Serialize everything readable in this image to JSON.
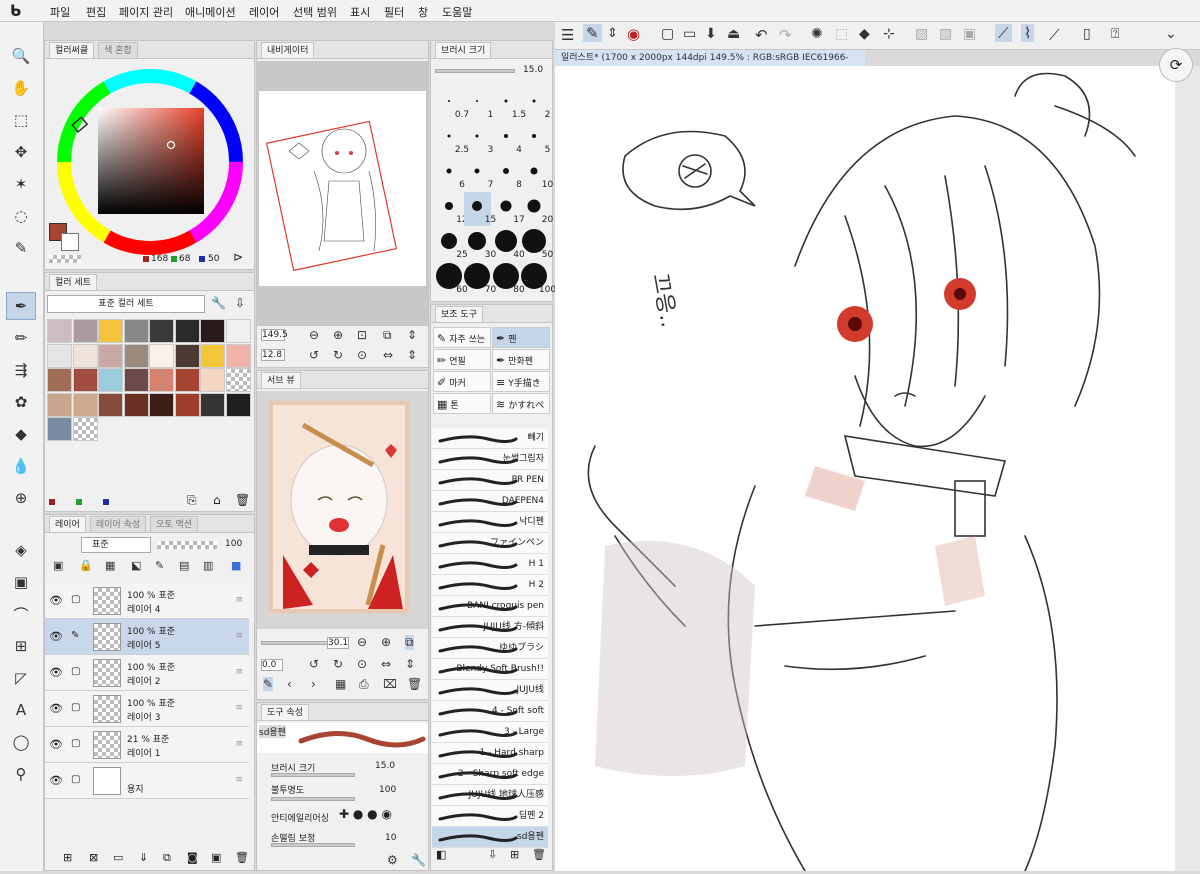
{
  "menu": [
    "파일",
    "편집",
    "페이지 관리",
    "애니메이션",
    "레이어",
    "선택 범위",
    "표시",
    "필터",
    "창",
    "도움말"
  ],
  "color_panel": {
    "tabs": [
      "컬러써클",
      "색 혼합"
    ],
    "r": "168",
    "g": "68",
    "b": "50",
    "main_color": "#a84432"
  },
  "color_set": {
    "tabs": [
      "컬러 세트"
    ],
    "set_name": "표준 컬러 세트",
    "swatches": [
      "#cdbcc4",
      "#a89aa0",
      "#f2c43d",
      "#888888",
      "#3a3a3a",
      "#2a2a2a",
      "#2b1a1a",
      "#f0f0f0",
      "#e5e5e5",
      "#efe3da",
      "#c9a9a3",
      "#9b8b7e",
      "#fbf1ea",
      "#4a3a32",
      "#f3c63c",
      "#f2b3aa",
      "#a06e58",
      "#a14c3e",
      "#9ccddf",
      "#6e4a4a",
      "#d5826f",
      "#a84432",
      "#f5d6c5",
      "checker",
      "#c9a58d",
      "#cdaa8d",
      "#864a3c",
      "#6b2f24",
      "#3b1e18",
      "#9d3d2b",
      "#333333",
      "#1e1e1e",
      "#7a8aa0",
      "checker"
    ]
  },
  "layers": {
    "tabs": [
      "레이어",
      "레이어 속성",
      "오토 액션"
    ],
    "blend": "표준",
    "opacity": "100",
    "items": [
      {
        "pct": "100 % 표준",
        "name": "레이어 4",
        "selected": false,
        "thumb": "checker"
      },
      {
        "pct": "100 % 표준",
        "name": "레이어 5",
        "selected": true,
        "thumb": "checker"
      },
      {
        "pct": "100 % 표준",
        "name": "레이어 2",
        "selected": false,
        "thumb": "checker"
      },
      {
        "pct": "100 % 표준",
        "name": "레이어 3",
        "selected": false,
        "thumb": "checker"
      },
      {
        "pct": "21 % 표준",
        "name": "레이어 1",
        "selected": false,
        "thumb": "checker"
      },
      {
        "pct": "",
        "name": "용지",
        "selected": false,
        "thumb": "white"
      }
    ]
  },
  "navigator": {
    "title": "내비게이터",
    "zoom": "149.5",
    "angle": "12.8"
  },
  "subview": {
    "title": "서브 뷰",
    "zoom": "30.1",
    "angle": "0.0"
  },
  "brush_size": {
    "title": "브러시 크기",
    "value": "15.0",
    "sizes": [
      {
        "v": "0.7",
        "d": 2
      },
      {
        "v": "1",
        "d": 2
      },
      {
        "v": "1.5",
        "d": 3
      },
      {
        "v": "2",
        "d": 3
      },
      {
        "v": "2.5",
        "d": 3
      },
      {
        "v": "3",
        "d": 3
      },
      {
        "v": "4",
        "d": 4
      },
      {
        "v": "5",
        "d": 4
      },
      {
        "v": "6",
        "d": 5
      },
      {
        "v": "7",
        "d": 5
      },
      {
        "v": "8",
        "d": 6
      },
      {
        "v": "10",
        "d": 7
      },
      {
        "v": "12",
        "d": 8
      },
      {
        "v": "15",
        "d": 10
      },
      {
        "v": "17",
        "d": 11
      },
      {
        "v": "20",
        "d": 13
      },
      {
        "v": "25",
        "d": 16
      },
      {
        "v": "30",
        "d": 18
      },
      {
        "v": "40",
        "d": 22
      },
      {
        "v": "50",
        "d": 24
      },
      {
        "v": "60",
        "d": 26
      },
      {
        "v": "70",
        "d": 26
      },
      {
        "v": "80",
        "d": 26
      },
      {
        "v": "100",
        "d": 26
      }
    ],
    "selected": "15"
  },
  "sub_tool": {
    "title": "보조 도구",
    "groups": [
      {
        "icon": "✎",
        "label": "자주 쓰는"
      },
      {
        "icon": "✒",
        "label": "펜"
      },
      {
        "icon": "✏",
        "label": "연필"
      },
      {
        "icon": "✒",
        "label": "만화펜"
      },
      {
        "icon": "✐",
        "label": "마커"
      },
      {
        "icon": "≡",
        "label": "Y手描き"
      },
      {
        "icon": "▦",
        "label": "톤"
      },
      {
        "icon": "≋",
        "label": "かすれぺ"
      }
    ],
    "brushes": [
      "빼기",
      "눈썹그림자",
      "PR PEN",
      "DAEPEN4",
      "낙디펜",
      "ファインペン",
      "H 1",
      "H 2",
      "BANI croquis pen",
      "JUJU线 方-傾斜",
      "ゆゆブラシ",
      "Blendy Soft Brush!!",
      "JUJU线",
      "4 - Soft soft",
      "3 - Large",
      "1 - Hard sharp",
      "2 - Sharp soft edge",
      "JUJU线 地球人压感",
      "딥펜 2",
      "sd용펜"
    ],
    "selected": "sd용펜"
  },
  "tool_property": {
    "title": "도구 속성",
    "brush_name": "sd용펜",
    "size_label": "브러시 크기",
    "size_value": "15.0",
    "opacity_label": "불투명도",
    "opacity_value": "100",
    "aa_label": "안티에일리어싱",
    "stab_label": "손떨림 보정",
    "stab_value": "10"
  },
  "document": {
    "title": "일러스트* (1700 x 2000px 144dpi 149.5% : RGB:sRGB IEC61966-2.1)"
  },
  "canvas_text": "끄응.."
}
